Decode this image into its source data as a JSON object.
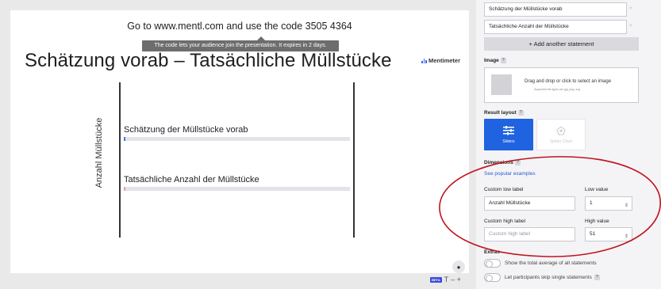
{
  "slide": {
    "join_instruction": "Go to www.mentl.com and use the code 3505 4364",
    "tooltip": "The code lets your audience join the presentation. It expires in 2 days.",
    "title": "Schätzung vorab – Tatsächliche Müllstücke",
    "brand": "Mentimeter",
    "axis_label": "Anzahl Müllstücke",
    "statements": [
      {
        "label": "Schätzung der Müllstücke vorab",
        "marker_color": "#4a7bd8",
        "value_fraction": 0.0
      },
      {
        "label": "Tatsächliche Anzahl der Müllstücke",
        "marker_color": "#e6a0b0",
        "value_fraction": 0.0
      }
    ],
    "user_icon": "user-icon",
    "beta_badge": "BETA",
    "text_tool": "T",
    "zoom_tools": "– +"
  },
  "panel": {
    "statement_inputs": [
      "Schätzung der Müllstücke vorab",
      "Tatsächliche Anzahl der Müllstücke"
    ],
    "remove_glyph": "×",
    "add_statement": "+ Add another statement",
    "image_label": "Image",
    "help_glyph": "?",
    "image_drop_text": "Drag and drop or click to select an image",
    "image_supported": "Supported file types are jpg, png, svg",
    "result_layout_label": "Result layout",
    "layouts": [
      {
        "label": "Sliders",
        "icon": "sliders-icon",
        "selected": true
      },
      {
        "label": "Spider Chart",
        "icon": "spider-chart-icon",
        "selected": false
      }
    ],
    "dimensions_label": "Dimensions",
    "popular_link": "See popular examples",
    "low_label_title": "Custom low label",
    "low_label_value": "Anzahl Müllstücke",
    "low_value_title": "Low value",
    "low_value": "1",
    "high_label_title": "Custom high label",
    "high_label_placeholder": "Custom high label",
    "high_value_title": "High value",
    "high_value": "51",
    "spinner_glyph": "⇕",
    "extras_label": "Extras",
    "extras": [
      {
        "label": "Show the total average of all statements",
        "on": false
      },
      {
        "label": "Let participants skip single statements",
        "on": false
      }
    ],
    "annotation_color": "#c0141e"
  }
}
